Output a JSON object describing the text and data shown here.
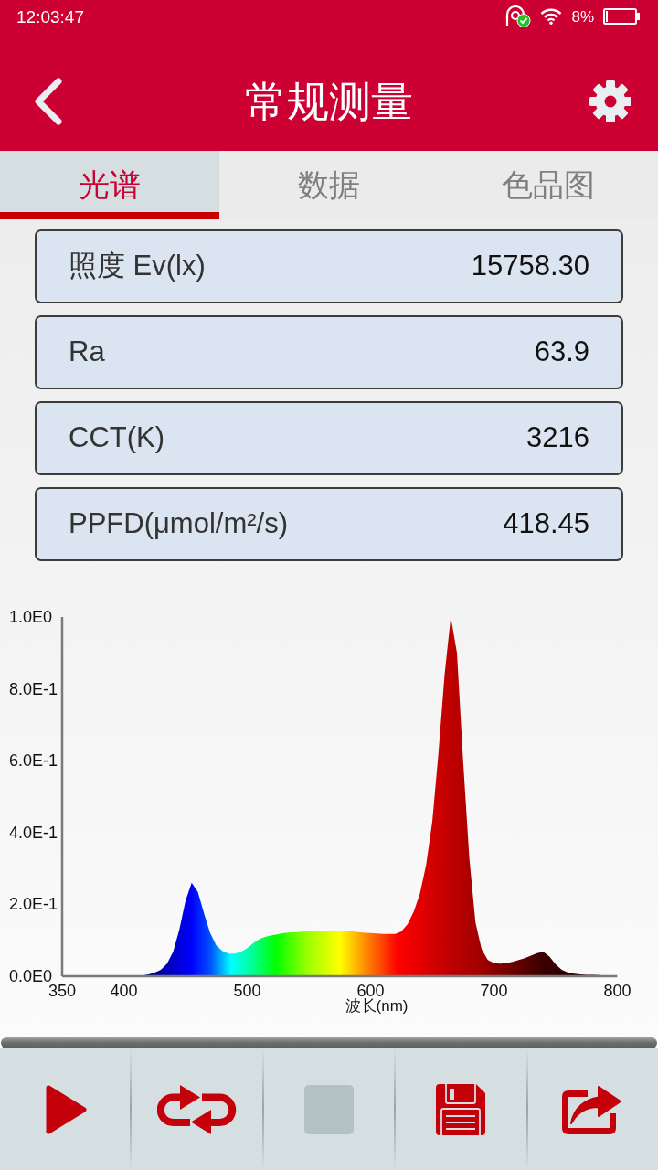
{
  "status_bar": {
    "time": "12:03:47",
    "battery_percent": "8%"
  },
  "header": {
    "title": "常规测量"
  },
  "tabs": [
    {
      "label": "光谱",
      "selected": true
    },
    {
      "label": "数据",
      "selected": false
    },
    {
      "label": "色品图",
      "selected": false
    }
  ],
  "readings": [
    {
      "label": "照度 Ev(lx)",
      "value": "15758.30"
    },
    {
      "label": "Ra",
      "value": "63.9"
    },
    {
      "label": "CCT(K)",
      "value": "3216"
    },
    {
      "label": "PPFD(μmol/m²/s)",
      "value": "418.45"
    }
  ],
  "spectrum": {
    "chart_data": {
      "type": "area",
      "xlabel": "波长(nm)",
      "x": [
        350,
        355,
        360,
        365,
        370,
        375,
        380,
        385,
        390,
        395,
        400,
        405,
        410,
        415,
        420,
        425,
        430,
        435,
        440,
        445,
        450,
        455,
        460,
        465,
        470,
        475,
        480,
        485,
        490,
        495,
        500,
        505,
        510,
        515,
        520,
        525,
        530,
        535,
        540,
        545,
        550,
        555,
        560,
        565,
        570,
        575,
        580,
        585,
        590,
        595,
        600,
        605,
        610,
        615,
        620,
        625,
        630,
        635,
        640,
        645,
        650,
        655,
        660,
        665,
        670,
        675,
        680,
        685,
        690,
        695,
        700,
        705,
        710,
        715,
        720,
        725,
        730,
        735,
        740,
        745,
        750,
        755,
        760,
        765,
        770,
        775,
        780,
        785,
        790,
        795,
        800
      ],
      "values": [
        0,
        0,
        0,
        0,
        0,
        0,
        0,
        0,
        0,
        0,
        0,
        0,
        0.001,
        0.002,
        0.005,
        0.01,
        0.018,
        0.035,
        0.068,
        0.13,
        0.21,
        0.26,
        0.235,
        0.175,
        0.12,
        0.085,
        0.07,
        0.063,
        0.063,
        0.068,
        0.078,
        0.092,
        0.104,
        0.11,
        0.114,
        0.117,
        0.12,
        0.122,
        0.123,
        0.124,
        0.125,
        0.126,
        0.127,
        0.127,
        0.127,
        0.127,
        0.126,
        0.125,
        0.123,
        0.121,
        0.12,
        0.119,
        0.118,
        0.118,
        0.118,
        0.125,
        0.145,
        0.18,
        0.23,
        0.31,
        0.43,
        0.62,
        0.84,
        1.0,
        0.9,
        0.6,
        0.33,
        0.15,
        0.075,
        0.045,
        0.037,
        0.035,
        0.036,
        0.04,
        0.045,
        0.05,
        0.057,
        0.064,
        0.068,
        0.055,
        0.033,
        0.018,
        0.01,
        0.007,
        0.005,
        0.004,
        0.004,
        0.003,
        0.002,
        0.002,
        0
      ],
      "xlim": [
        350,
        800
      ],
      "ylim": [
        0,
        1
      ],
      "xticks": [
        350,
        400,
        500,
        600,
        700,
        800
      ],
      "yticks": [
        {
          "value": 0,
          "label": "0.0E0"
        },
        {
          "value": 0.2,
          "label": "2.0E-1"
        },
        {
          "value": 0.4,
          "label": "4.0E-1"
        },
        {
          "value": 0.6,
          "label": "6.0E-1"
        },
        {
          "value": 0.8,
          "label": "8.0E-1"
        },
        {
          "value": 1,
          "label": "1.0E0"
        }
      ]
    }
  },
  "toolbar": [
    {
      "kind": "play",
      "disabled": false
    },
    {
      "kind": "repeat",
      "disabled": false
    },
    {
      "kind": "stop",
      "disabled": true
    },
    {
      "kind": "save",
      "disabled": false
    },
    {
      "kind": "share",
      "disabled": false
    }
  ]
}
